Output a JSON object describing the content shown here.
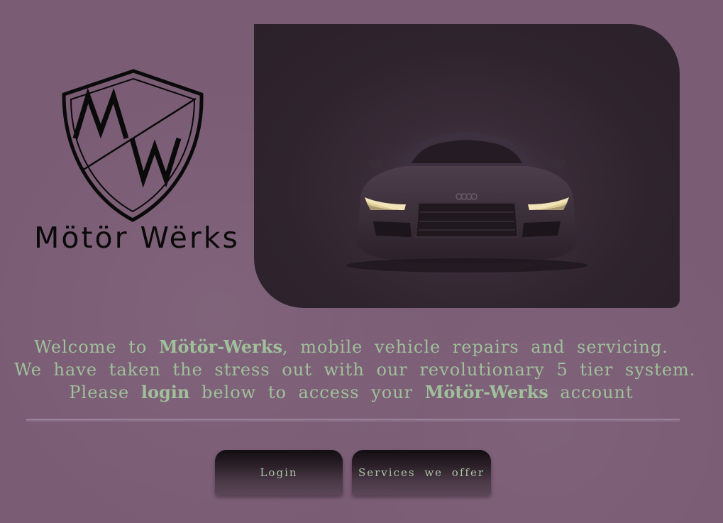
{
  "logo": {
    "monogram": "MW",
    "brand_name": "Mötör Wërks"
  },
  "hero": {
    "icon": "car-headlights-image"
  },
  "welcome": {
    "line1_prefix": "Welcome to ",
    "line1_brand": "Mötör-Werks",
    "line1_suffix": ", mobile vehicle repairs and servicing.",
    "line2": "We have taken the stress out with our revolutionary 5 tier system.",
    "line3_prefix": "Please ",
    "line3_login": "login",
    "line3_middle": " below to access your ",
    "line3_brand": "Mötör-Werks",
    "line3_suffix": " account"
  },
  "buttons": {
    "login_label": "Login",
    "services_label": "Services we offer"
  },
  "colors": {
    "background": "#7a5c74",
    "text_accent": "#9fc09a",
    "button_text": "#a9c4a5"
  }
}
